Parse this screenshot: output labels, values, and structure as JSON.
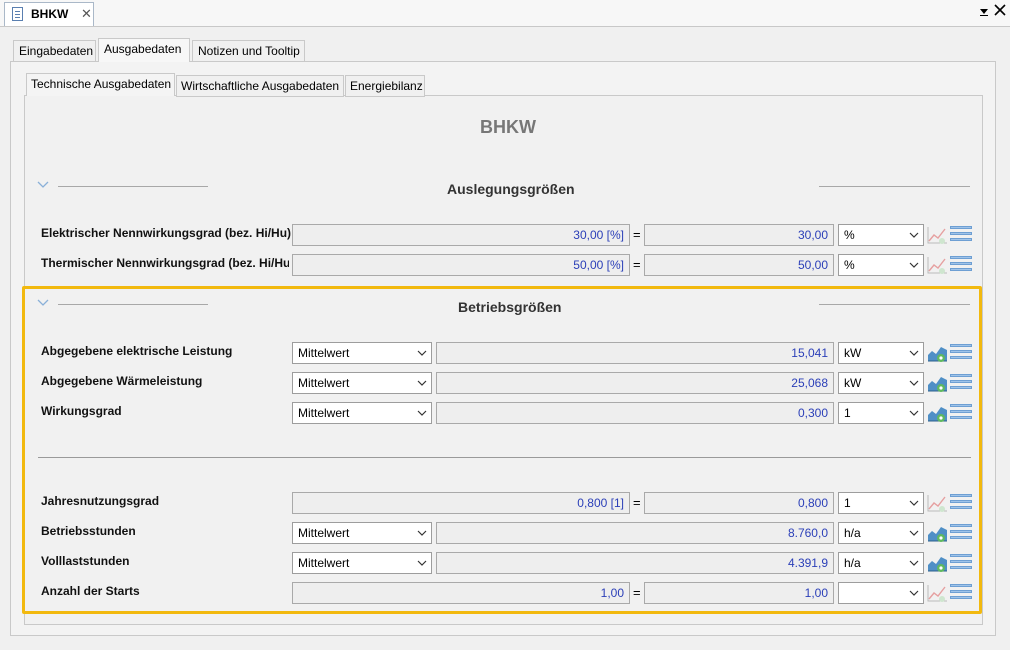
{
  "window": {
    "doc_title": "BHKW"
  },
  "main_tabs": [
    "Eingabedaten",
    "Ausgabedaten",
    "Notizen und Tooltip"
  ],
  "sub_tabs": [
    "Technische Ausgabedaten",
    "Wirtschaftliche Ausgabedaten",
    "Energiebilanz"
  ],
  "page_title": "BHKW",
  "sections": {
    "design": {
      "title": "Auslegungsgrößen",
      "rows": [
        {
          "label": "Elektrischer Nennwirkungsgrad (bez. Hi/Hu)",
          "left_value": "30,00 [%]",
          "right_value": "30,00",
          "unit": "%"
        },
        {
          "label": "Thermischer Nennwirkungsgrad (bez. Hi/Hu)",
          "left_value": "50,00 [%]",
          "right_value": "50,00",
          "unit": "%"
        }
      ]
    },
    "operation": {
      "title": "Betriebsgrößen",
      "rows": [
        {
          "label": "Abgegebene elektrische Leistung",
          "mode": "Mittelwert",
          "value": "15,041",
          "unit": "kW"
        },
        {
          "label": "Abgegebene Wärmeleistung",
          "mode": "Mittelwert",
          "value": "25,068",
          "unit": "kW"
        },
        {
          "label": "Wirkungsgrad",
          "mode": "Mittelwert",
          "value": "0,300",
          "unit": "1"
        },
        {
          "label": "Jahresnutzungsgrad",
          "left_value": "0,800 [1]",
          "right_value": "0,800",
          "unit": "1"
        },
        {
          "label": "Betriebsstunden",
          "mode": "Mittelwert",
          "value": "8.760,0",
          "unit": "h/a"
        },
        {
          "label": "Volllaststunden",
          "mode": "Mittelwert",
          "value": "4.391,9",
          "unit": "h/a"
        },
        {
          "label": "Anzahl der Starts",
          "left_value": "1,00",
          "right_value": "1,00",
          "unit": ""
        }
      ]
    }
  },
  "symbols": {
    "equals": "=",
    "close": "✕",
    "dropdown": "▾",
    "collapse": "﹀"
  },
  "colors": {
    "highlight": "#f2b90f",
    "value_text": "#2b3fb8"
  }
}
